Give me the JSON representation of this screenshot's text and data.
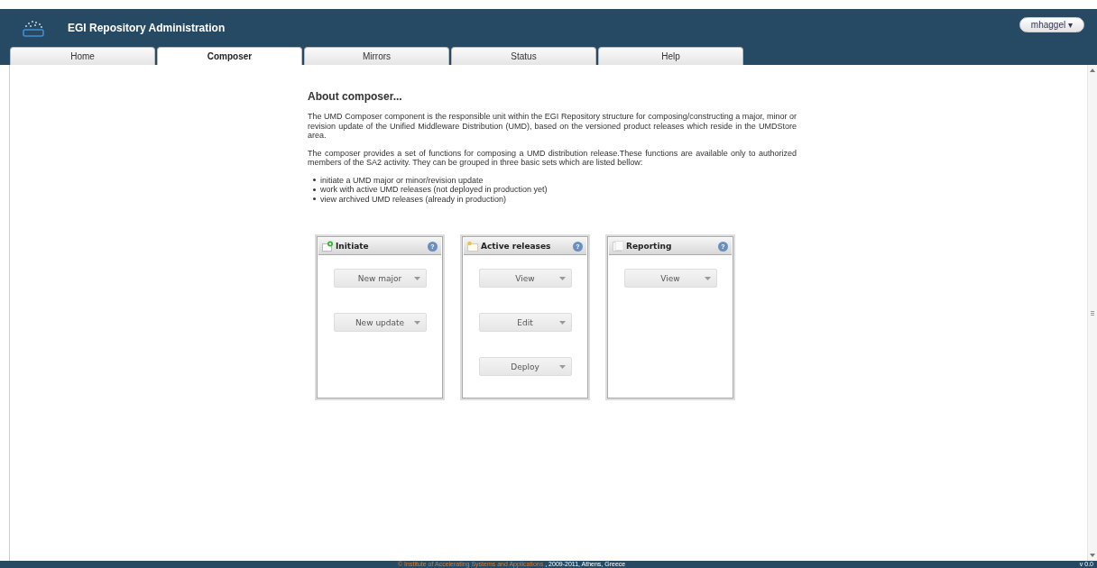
{
  "header": {
    "title": "EGI Repository Administration",
    "user_menu": "mhaggel ▾"
  },
  "tabs": [
    {
      "label": "Home",
      "selected": false
    },
    {
      "label": "Composer",
      "selected": true
    },
    {
      "label": "Mirrors",
      "selected": false
    },
    {
      "label": "Status",
      "selected": false
    },
    {
      "label": "Help",
      "selected": false
    }
  ],
  "about": {
    "heading": "About composer...",
    "paragraphs": [
      "The UMD Composer component is the responsible unit within the EGI Repository structure for composing/constructing a major, minor or revision update of the Unified Middleware Distribution (UMD), based on the versioned product releases which reside in the UMDStore area.",
      "The composer provides a set of functions for composing a UMD distribution release.These functions are available only to authorized members of the SA2 activity. They can be grouped in three basic sets which are listed bellow:"
    ],
    "bullets": [
      "initiate a UMD major or minor/revision update",
      "work with active UMD releases (not deployed in production yet)",
      "view archived UMD releases (already in production)"
    ]
  },
  "panels": [
    {
      "title": "Initiate",
      "kind": "new",
      "help": "?",
      "buttons": [
        "New major",
        "New update"
      ]
    },
    {
      "title": "Active releases",
      "kind": "folder",
      "help": "?",
      "buttons": [
        "View",
        "Edit",
        "Deploy"
      ]
    },
    {
      "title": "Reporting",
      "kind": "document",
      "help": "?",
      "buttons": [
        "View"
      ]
    }
  ],
  "footer": {
    "owner": "© Institute of Accelerating Systems and Applications",
    "rest": ", 2009-2011, Athens, Greece",
    "version": "v 0.0"
  }
}
